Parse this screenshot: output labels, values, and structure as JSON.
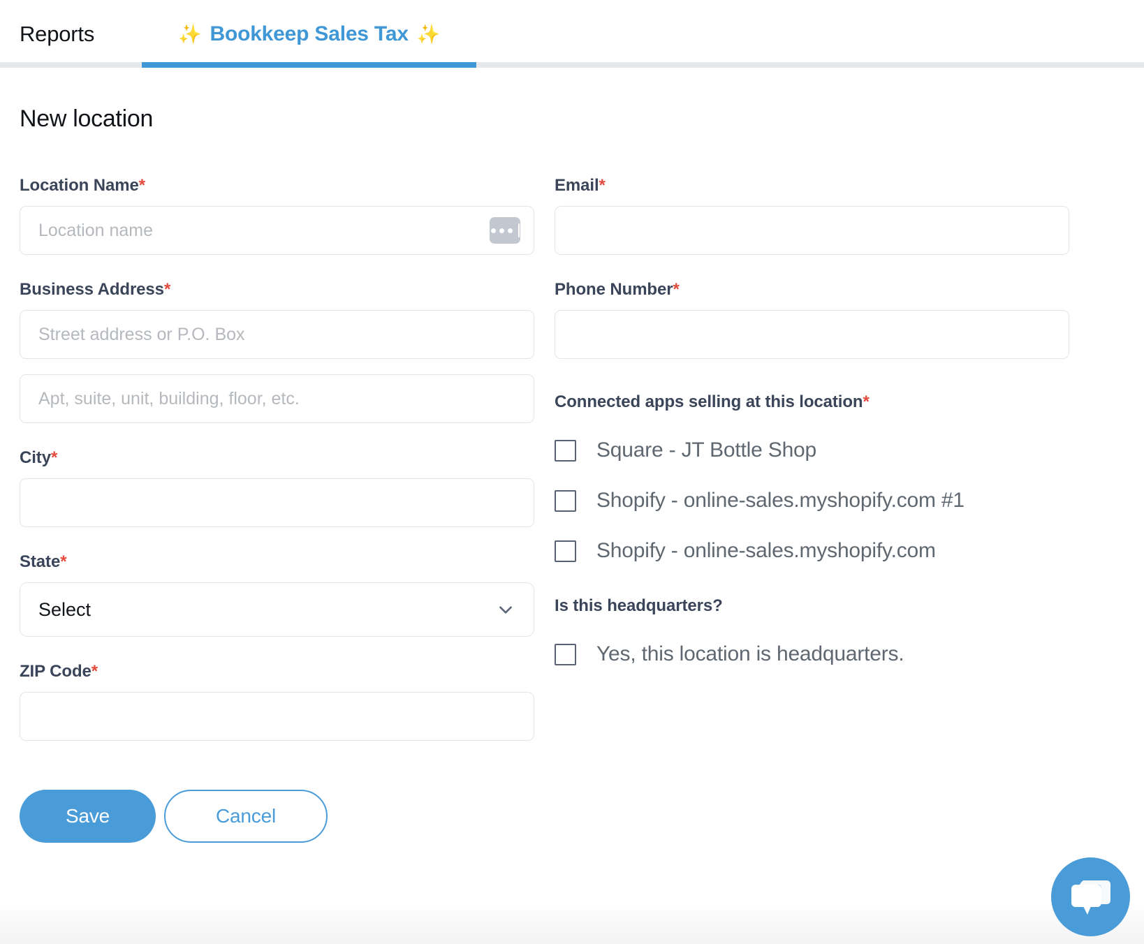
{
  "tabs": [
    {
      "label": "Reports",
      "active": false
    },
    {
      "label": "Bookkeep Sales Tax",
      "active": true,
      "sparkle": "✨"
    }
  ],
  "page": {
    "title": "New location"
  },
  "form": {
    "left": {
      "location_name": {
        "label": "Location Name",
        "required_marker": "*",
        "placeholder": "Location name",
        "value": "",
        "badge_icon": "ellipsis-icon"
      },
      "business_address": {
        "label": "Business Address",
        "required_marker": "*",
        "line1_placeholder": "Street address or P.O. Box",
        "line1_value": "",
        "line2_placeholder": "Apt, suite, unit, building, floor, etc.",
        "line2_value": ""
      },
      "city": {
        "label": "City",
        "required_marker": "*",
        "placeholder": "",
        "value": ""
      },
      "state": {
        "label": "State",
        "required_marker": "*",
        "selected": "Select",
        "chevron_icon": "chevron-down-icon"
      },
      "zip": {
        "label": "ZIP Code",
        "required_marker": "*",
        "placeholder": "",
        "value": ""
      }
    },
    "right": {
      "email": {
        "label": "Email",
        "required_marker": "*",
        "placeholder": "",
        "value": ""
      },
      "phone": {
        "label": "Phone Number",
        "required_marker": "*",
        "placeholder": "",
        "value": ""
      },
      "connected_apps": {
        "label": "Connected apps selling at this location",
        "required_marker": "*",
        "options": [
          {
            "label": "Square - JT Bottle Shop",
            "checked": false
          },
          {
            "label": "Shopify - online-sales.myshopify.com #1",
            "checked": false
          },
          {
            "label": "Shopify - online-sales.myshopify.com",
            "checked": false
          }
        ]
      },
      "headquarters": {
        "label": "Is this headquarters?",
        "options": [
          {
            "label": "Yes, this location is headquarters.",
            "checked": false
          }
        ]
      }
    }
  },
  "actions": {
    "save_label": "Save",
    "cancel_label": "Cancel"
  },
  "chat": {
    "icon": "chat-bubbles-icon"
  },
  "colors": {
    "accent_blue": "#4a9cd8",
    "tab_blue": "#3f97d6",
    "required_red": "#e24a3c",
    "label_navy": "#3b4559",
    "placeholder_grey": "#b5b9bd",
    "border_grey": "#e3e5e7",
    "sparkle_yellow": "#ffc93c"
  }
}
